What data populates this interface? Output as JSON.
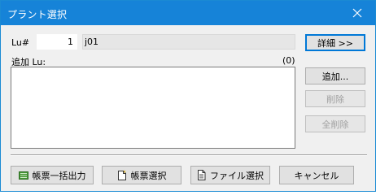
{
  "window": {
    "title": "プラント選択",
    "close_icon": "close-icon"
  },
  "lu": {
    "label": "Lu#",
    "number": "1",
    "name": "j01"
  },
  "list": {
    "label": "追加 Lu:",
    "count": "(0)",
    "items": []
  },
  "side_buttons": {
    "detail": "詳細 >>",
    "add": "追加...",
    "delete": "削除",
    "delete_all": "全削除"
  },
  "bottom_buttons": {
    "batch_output": "帳票一括出力",
    "form_select": "帳票選択",
    "file_select": "ファイル選択",
    "cancel": "キャンセル"
  },
  "colors": {
    "titlebar": "#1683d8",
    "accent": "#0078d7",
    "disabled_text": "#a0a0a0"
  }
}
